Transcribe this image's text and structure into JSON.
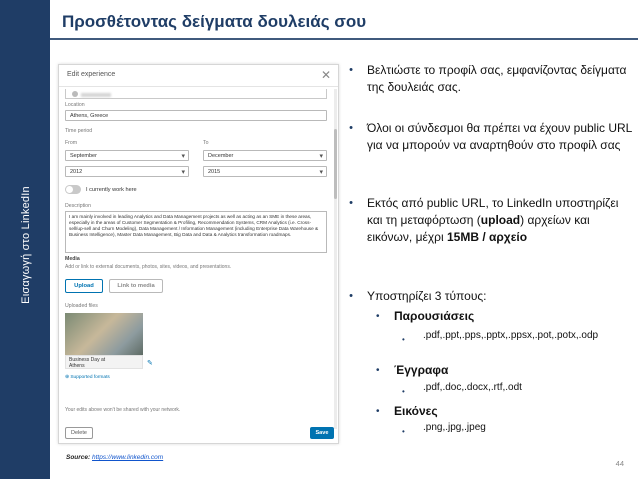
{
  "sidebar": {
    "label": "Εισαγωγή στο LinkedIn"
  },
  "slide": {
    "title": "Προσθέτοντας δείγματα δουλειάς σου",
    "page_number": "44"
  },
  "dialog": {
    "title": "Edit experience",
    "close_icon": "close-icon",
    "location": {
      "label": "Location",
      "value": "Athens, Greece"
    },
    "time_period": {
      "label": "Time period",
      "from_label": "From",
      "to_label": "To",
      "from_month": "September",
      "from_year": "2012",
      "to_month": "December",
      "to_year": "2015"
    },
    "currently_work_label": "I currently work here",
    "description": {
      "label": "Description",
      "value": "I am mainly involved in leading Analytics and Data Management projects as well as acting as an SME in these areas, especially in the areas of Customer Segmentation & Profiling, Recommendation Systems, CRM Analytics (i.e. Cross-sell/up-sell and Churn Modeling), Data Management / Information Management (including Enterprise Data Warehouse & Business Intelligence), Master Data Management, Big Data and Data & Analytics transformation roadmaps."
    },
    "media": {
      "label": "Media",
      "hint": "Add or link to external documents, photos, sites, videos, and presentations.",
      "upload_label": "Upload",
      "link_label": "Link to media"
    },
    "uploaded": {
      "label": "Uploaded files",
      "caption_line1": "Business Day at",
      "caption_line2": "Athens",
      "supported_formats": "Supported formats"
    },
    "footer_note": "Your edits above won't be shared with your network.",
    "delete_label": "Delete",
    "save_label": "Save"
  },
  "bullets": [
    {
      "text": "Βελτιώστε το προφίλ σας, εμφανίζοντας δείγματα της δουλειάς σας."
    },
    {
      "text": "Όλοι οι σύνδεσμοι θα πρέπει να έχουν public URL για να μπορούν να αναρτηθούν στο προφίλ σας"
    },
    {
      "text_before": "Εκτός από public URL, το LinkedIn υποστηρίζει και τη μεταφόρτωση (",
      "bold1": "upload",
      "text_mid": ") αρχείων και εικόνων, μέχρι ",
      "bold2": "15MB / αρχείο"
    },
    {
      "text": "Υποστηρίζει 3 τύπους:",
      "subitems": [
        {
          "label": "Παρουσιάσεις",
          "formats": ".pdf,.ppt,.pps,.pptx,.ppsx,.pot,.potx,.odp"
        },
        {
          "label": "Έγγραφα",
          "formats": ".pdf,.doc,.docx,.rtf,.odt"
        },
        {
          "label": "Εικόνες",
          "formats": ".png,.jpg,.jpeg"
        }
      ]
    }
  ],
  "source": {
    "label": "Source:",
    "url": "https://www.linkedin.com"
  },
  "colors": {
    "brand_navy": "#1f3d66",
    "linkedin_blue": "#0073b1"
  }
}
